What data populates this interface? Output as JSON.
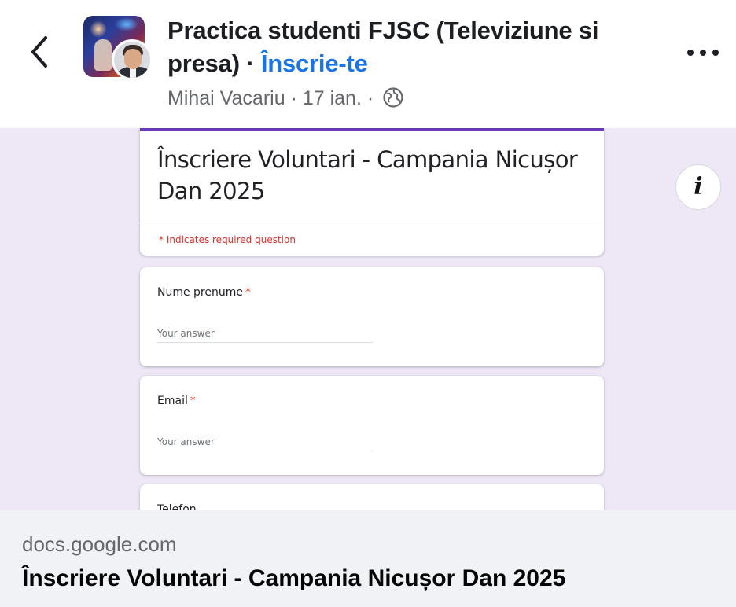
{
  "post": {
    "group_name": "Practica studenti FJSC (Televiziune si presa)",
    "separator": "·",
    "join_label": "Înscrie-te",
    "author": "Mihai Vacariu",
    "dot": "·",
    "date": "17 ian.",
    "dot2": "·",
    "privacy_icon": "globe-icon",
    "more_icon": "more-options-icon",
    "back_icon": "back-arrow-icon"
  },
  "form": {
    "title": "Înscriere Voluntari - Campania Nicușor Dan 2025",
    "required_note": "* Indicates required question",
    "questions": [
      {
        "label": "Nume prenume",
        "required_mark": "*",
        "placeholder": "Your answer"
      },
      {
        "label": "Email",
        "required_mark": "*",
        "placeholder": "Your answer"
      },
      {
        "label": "Telefon"
      }
    ],
    "accent_color": "#673ab7",
    "background_color": "#ede7f6"
  },
  "info_button": {
    "icon": "info-icon",
    "glyph": "i"
  },
  "link_caption": {
    "domain": "docs.google.com",
    "title": "Înscriere Voluntari - Campania Nicușor Dan 2025"
  },
  "colors": {
    "link_blue": "#1b74e4",
    "meta_gray": "#65676b",
    "required_red": "#d93025"
  }
}
